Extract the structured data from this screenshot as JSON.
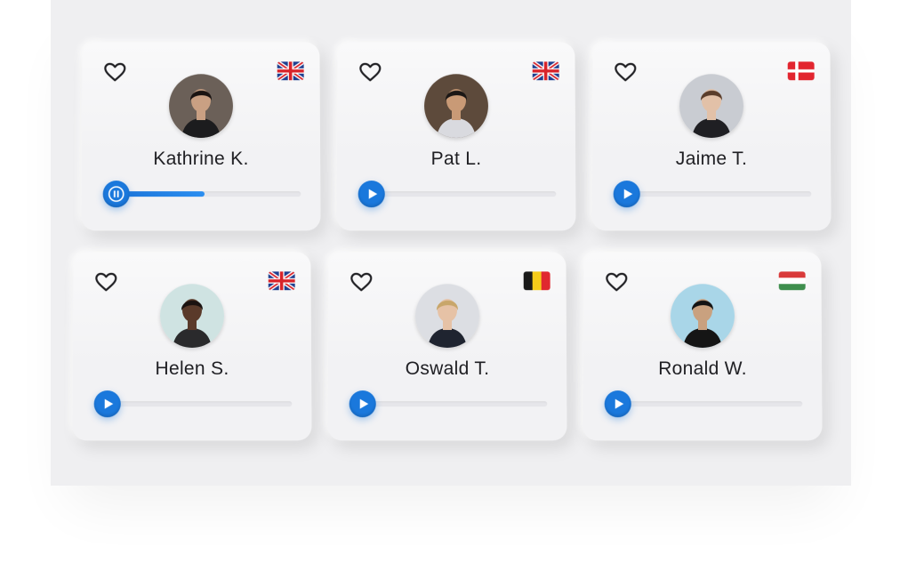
{
  "cards": [
    {
      "name": "Kathrine K.",
      "flag": "uk",
      "playing": true,
      "progress": 0.5,
      "skin": "#c9a083",
      "hair": "#1a1412",
      "shirt": "#1c1c1e",
      "bg": "#6b6058"
    },
    {
      "name": "Pat L.",
      "flag": "uk",
      "playing": false,
      "progress": 0,
      "skin": "#c99a76",
      "hair": "#1b1715",
      "shirt": "#d9dadf",
      "bg": "#5d4a3b"
    },
    {
      "name": "Jaime T.",
      "flag": "denmark",
      "playing": false,
      "progress": 0,
      "skin": "#e2c1a8",
      "hair": "#5a3d2b",
      "shirt": "#1f1f23",
      "bg": "#c9ccd2"
    },
    {
      "name": "Helen S.",
      "flag": "uk",
      "playing": false,
      "progress": 0,
      "skin": "#5a3a2a",
      "hair": "#1a1210",
      "shirt": "#2a2a2c",
      "bg": "#cfe3e2"
    },
    {
      "name": "Oswald T.",
      "flag": "belgium",
      "playing": false,
      "progress": 0,
      "skin": "#e6c2a6",
      "hair": "#c8a66a",
      "shirt": "#1f2430",
      "bg": "#dcdee3"
    },
    {
      "name": "Ronald W.",
      "flag": "hungary",
      "playing": false,
      "progress": 0,
      "skin": "#c9a17f",
      "hair": "#131313",
      "shirt": "#151515",
      "bg": "#a9d6e8"
    }
  ],
  "colors": {
    "accent": "#1a78dc",
    "heart": "#1e1e22"
  }
}
